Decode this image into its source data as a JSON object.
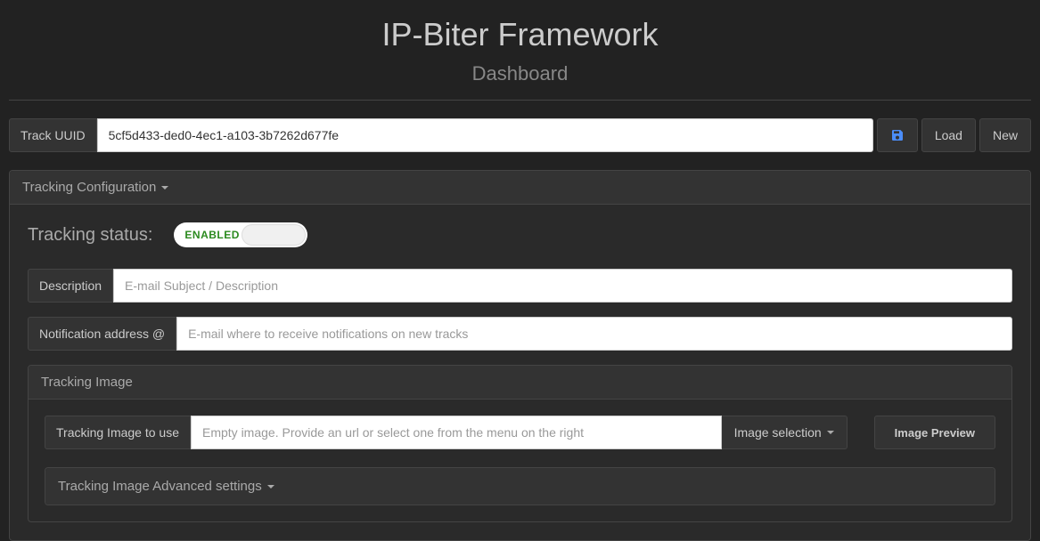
{
  "header": {
    "title": "IP-Biter Framework",
    "subtitle": "Dashboard"
  },
  "track": {
    "label": "Track UUID",
    "value": "5cf5d433-ded0-4ec1-a103-3b7262d677fe",
    "load_label": "Load",
    "new_label": "New"
  },
  "config": {
    "heading": "Tracking Configuration",
    "status_label": "Tracking status:",
    "toggle_text": "ENABLED",
    "description_label": "Description",
    "description_placeholder": "E-mail Subject / Description",
    "notification_label": "Notification address @",
    "notification_placeholder": "E-mail where to receive notifications on new tracks",
    "image": {
      "heading": "Tracking Image",
      "use_label": "Tracking Image to use",
      "use_placeholder": "Empty image. Provide an url or select one from the menu on the right",
      "selection_label": "Image selection",
      "preview_label": "Image Preview",
      "advanced_heading": "Tracking Image Advanced settings"
    }
  }
}
